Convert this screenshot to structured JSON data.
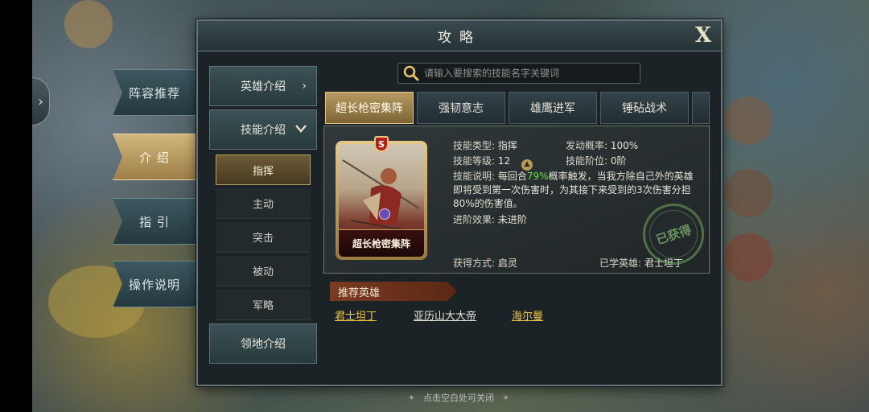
{
  "window": {
    "title": "攻略",
    "close_label": "X"
  },
  "categories": [
    {
      "label": "阵容推荐",
      "active": false
    },
    {
      "label": "介 绍",
      "active": true
    },
    {
      "label": "指 引",
      "active": false
    },
    {
      "label": "操作说明",
      "active": false
    }
  ],
  "nav": {
    "hero_intro": "英雄介绍",
    "skill_intro": "技能介绍",
    "territory_intro": "领地介绍",
    "sub_items": [
      "指挥",
      "主动",
      "突击",
      "被动",
      "军略"
    ],
    "active_sub": "指挥"
  },
  "search": {
    "placeholder": "请输入要搜索的技能名字关键词",
    "value": ""
  },
  "skill_tabs": [
    "超长枪密集阵",
    "强韧意志",
    "雄鹰进军",
    "锤砧战术"
  ],
  "active_tab": "超长枪密集阵",
  "skill": {
    "card_name": "超长枪密集阵",
    "card_badge": "S",
    "type_label": "技能类型:",
    "type_value": "指挥",
    "rate_label": "发动概率:",
    "rate_value": "100%",
    "level_label": "技能等级:",
    "level_value": "12",
    "rank_label": "技能阶位:",
    "rank_value": "0阶",
    "desc_label": "技能说明:",
    "desc_pre": "每回合",
    "desc_pct": "79%",
    "desc_post": "概率触发，当我方除自己外的英雄即将受到第一次伤害时，为其接下来受到的3次伤害分担80%的伤害值。",
    "advance_label": "进阶效果:",
    "advance_value": "未进阶",
    "obtain_label": "获得方式:",
    "obtain_value": "启灵",
    "learned_label": "已学英雄:",
    "learned_value": "君士坦丁",
    "stamp": "已获得"
  },
  "recommend": {
    "title": "推荐英雄",
    "heroes": [
      {
        "name": "君士坦丁",
        "color": "#f0c64a"
      },
      {
        "name": "亚历山大大帝",
        "color": "#e9e6dc"
      },
      {
        "name": "海尔曼",
        "color": "#f0c64a"
      }
    ]
  },
  "footer": {
    "hint": "点击空白处可关闭"
  },
  "colors": {
    "accent_gold": "#b79a62",
    "highlight_green": "#6fe04f",
    "panel_bg": "#1c2326"
  }
}
